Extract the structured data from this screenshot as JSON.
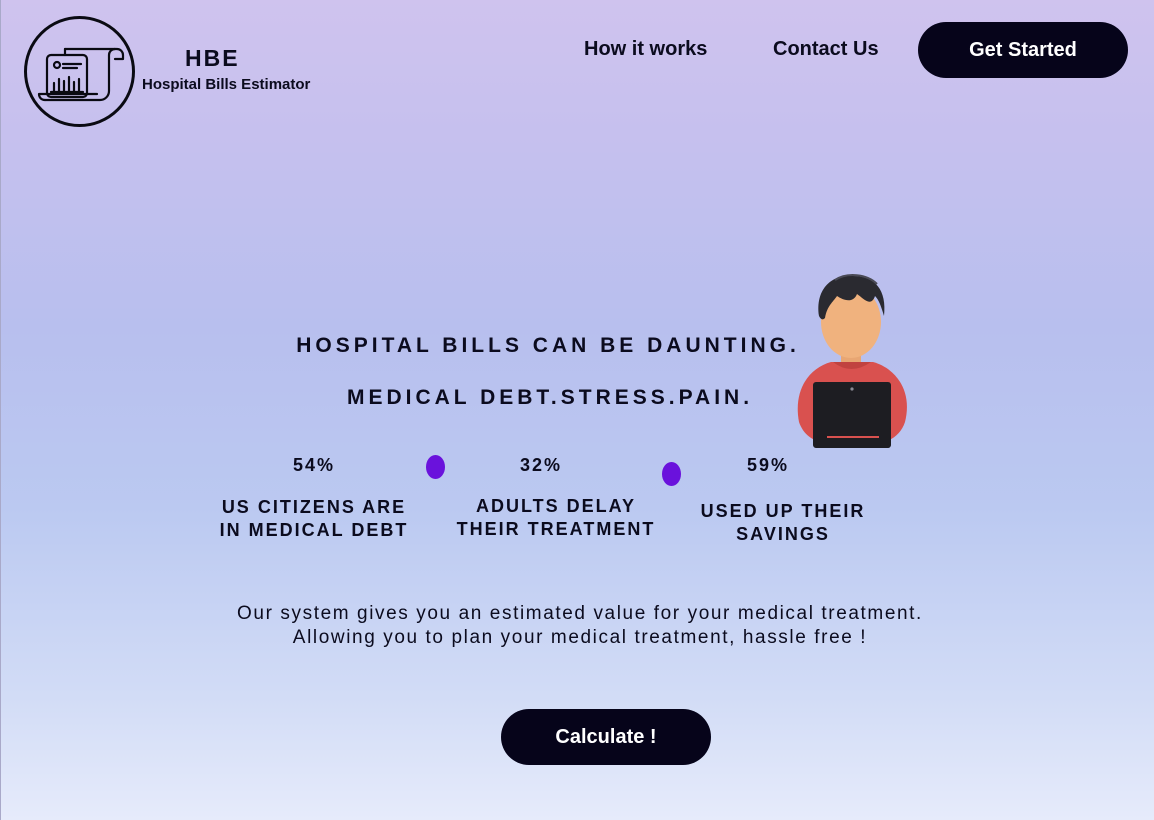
{
  "brand": {
    "abbr": "HBE",
    "name": "Hospital Bills Estimator",
    "logo_icon": "bill-chart-scroll-icon"
  },
  "nav": {
    "how_it_works": "How it works",
    "contact_us": "Contact Us",
    "get_started": "Get Started"
  },
  "hero": {
    "headline_1": "HOSPITAL BILLS CAN BE DAUNTING.",
    "headline_2": "MEDICAL DEBT.STRESS.PAIN.",
    "illustration": "person-with-laptop"
  },
  "stats": [
    {
      "value": "54%",
      "label_line1": "US CITIZENS ARE",
      "label_line2": "IN MEDICAL DEBT"
    },
    {
      "value": "32%",
      "label_line1": "ADULTS DELAY",
      "label_line2": "THEIR TREATMENT"
    },
    {
      "value": "59%",
      "label_line1": "USED UP THEIR",
      "label_line2": "SAVINGS"
    }
  ],
  "description": {
    "line1": "Our system gives you an estimated value for your medical treatment.",
    "line2": "Allowing you to plan your medical treatment, hassle free !"
  },
  "cta": {
    "calculate": "Calculate !"
  },
  "colors": {
    "button_bg": "#06041a",
    "button_text": "#ffffff",
    "accent_dot": "#6a12dc",
    "shirt": "#d9514f",
    "laptop": "#1d1d22"
  }
}
